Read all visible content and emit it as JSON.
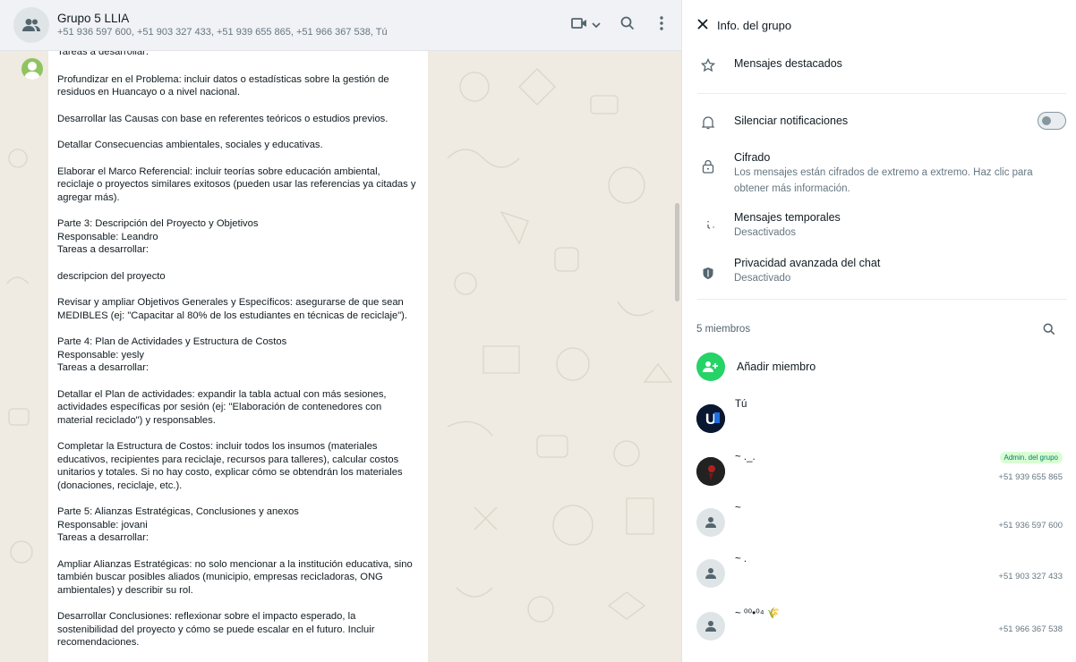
{
  "chat": {
    "title": "Grupo 5 LLIA",
    "participants": "+51 936 597 600, +51 903 327 433, +51 939 655 865, +51 966 367 538, Tú",
    "icons": [
      "group-avatar-icon",
      "video-call-icon",
      "chevron-down-icon",
      "search-icon",
      "menu-dots-icon"
    ]
  },
  "message": {
    "paragraphs": [
      "Tareas a desarrollar:",
      "Profundizar en el Problema: incluir datos o estadísticas sobre la gestión de residuos en Huancayo o a nivel nacional.",
      "Desarrollar las Causas con base en referentes teóricos o estudios previos.",
      "Detallar Consecuencias ambientales, sociales y educativas.",
      "Elaborar el Marco Referencial: incluir teorías sobre educación ambiental, reciclaje o proyectos similares exitosos (pueden usar las referencias ya citadas y agregar más).",
      "Parte 3: Descripción del Proyecto y Objetivos\nResponsable: Leandro\nTareas a desarrollar:",
      "descripcion del proyecto",
      "Revisar y ampliar Objetivos Generales y Específicos: asegurarse de que sean MEDIBLES (ej: \"Capacitar al 80% de los estudiantes en técnicas de reciclaje\").",
      "Parte 4: Plan de Actividades y Estructura de Costos\nResponsable: yesly\nTareas a desarrollar:",
      "Detallar el Plan de actividades: expandir la tabla actual con más sesiones, actividades específicas por sesión (ej: \"Elaboración de contenedores con material reciclado\") y responsables.",
      "Completar la Estructura de Costos: incluir todos los insumos (materiales educativos, recipientes para reciclaje, recursos para talleres), calcular costos unitarios y totales. Si no hay costo, explicar cómo se obtendrán los materiales (donaciones, reciclaje, etc.).",
      "Parte 5: Alianzas Estratégicas, Conclusiones y anexos\nResponsable: jovani\nTareas a desarrollar:",
      "Ampliar Alianzas Estratégicas: no solo mencionar a la institución educativa, sino también buscar posibles aliados (municipio, empresas recicladoras, ONG ambientales) y describir su rol.",
      "Desarrollar Conclusiones: reflexionar sobre el impacto esperado, la sostenibilidad del proyecto y cómo se puede escalar en el futuro. Incluir recomendaciones."
    ]
  },
  "info": {
    "header": "Info. del grupo",
    "starred": "Mensajes destacados",
    "mute": "Silenciar notificaciones",
    "mute_enabled": false,
    "encryption_title": "Cifrado",
    "encryption_sub": "Los mensajes están cifrados de extremo a extremo. Haz clic para obtener más información.",
    "disappearing_title": "Mensajes temporales",
    "disappearing_sub": "Desactivados",
    "privacy_title": "Privacidad avanzada del chat",
    "privacy_sub": "Desactivado",
    "members_count": "5 miembros",
    "add_member": "Añadir miembro",
    "members": [
      {
        "name": "Tú",
        "phone": "",
        "badge": ""
      },
      {
        "name": "~ ._.",
        "phone": "+51 939 655 865",
        "badge": "Admin. del grupo"
      },
      {
        "name": "~",
        "phone": "+51 936 597 600",
        "badge": ""
      },
      {
        "name": "~ .",
        "phone": "+51 903 327 433",
        "badge": ""
      },
      {
        "name": "~ ⁰⁰•⁰⁴ 🌾",
        "phone": "+51 966 367 538",
        "badge": ""
      }
    ],
    "colors": {
      "accent": "#25d366",
      "badge_bg": "#d9fdd3",
      "badge_text": "#008069"
    }
  }
}
